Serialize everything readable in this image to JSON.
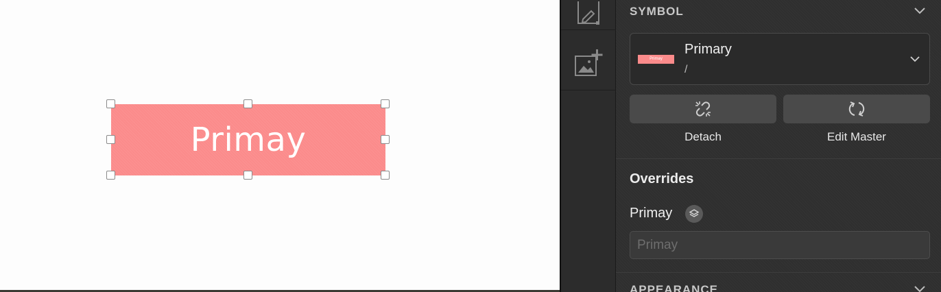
{
  "canvas": {
    "symbol_text": "Primay",
    "symbol_color": "#fb8b8b"
  },
  "tools": {
    "icons": [
      "edit-shape-icon",
      "add-image-icon"
    ]
  },
  "inspector": {
    "symbol_section_title": "SYMBOL",
    "symbol": {
      "name": "Primary",
      "path": "/",
      "thumbnail_text": "Primay"
    },
    "actions": {
      "detach_label": "Detach",
      "edit_master_label": "Edit Master"
    },
    "overrides": {
      "title": "Overrides",
      "field_label": "Primay",
      "field_placeholder": "Primay"
    },
    "appearance_section_title": "APPEARANCE"
  },
  "colors": {
    "accent": "#fb8b8b",
    "panel_bg": "#2f2f2f",
    "button_bg": "#4a4a4a"
  }
}
